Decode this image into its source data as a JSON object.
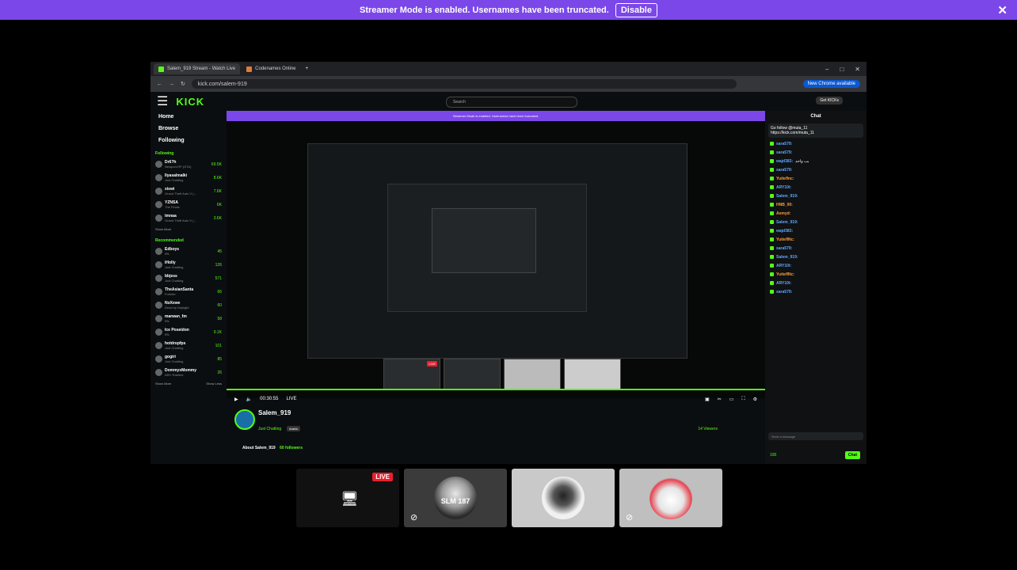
{
  "banner": {
    "message": "Streamer Mode is enabled. Usernames have been truncated.",
    "disable_label": "Disable",
    "close": "✕"
  },
  "browser": {
    "tab1": "Salem_919 Stream - Watch Live",
    "tab2": "Codenames Online",
    "new_tab": "+",
    "url": "kick.com/salem-919",
    "chrome_button": "New Chrome available",
    "controls": {
      "min": "–",
      "max": "□",
      "close": "✕"
    }
  },
  "kick": {
    "logo": "KICK",
    "search_placeholder": "Search",
    "get_kicks": "Get KICKs",
    "inner_banner": "Streamer Mode is enabled. Usernames have been truncated.",
    "nav": [
      "Home",
      "Browse",
      "Following"
    ],
    "following_title": "Following",
    "following": [
      {
        "name": "Dr6?h",
        "sub": "Newport-RP (GTA)",
        "count": "69.5K"
      },
      {
        "name": "llyasalmalki",
        "sub": "Just Chatting",
        "count": "8.6K"
      },
      {
        "name": "xiswi",
        "sub": "Grand Theft Auto V (...",
        "count": "7.6K"
      },
      {
        "name": "YZNSA",
        "sub": "The Finals",
        "count": "6K"
      },
      {
        "name": "tmnaa",
        "sub": "Grand Theft Auto V (...",
        "count": "3.6K"
      }
    ],
    "show_more": "Show More",
    "recommended_title": "Recommended",
    "recommended": [
      {
        "name": "Edboys",
        "sub": "IRL",
        "count": "45"
      },
      {
        "name": "iHolly",
        "sub": "Just Chatting",
        "count": "126"
      },
      {
        "name": "bbjess",
        "sub": "Just Chatting",
        "count": "571"
      },
      {
        "name": "TheAsianSanta",
        "sub": "Fortnite",
        "count": "66"
      },
      {
        "name": "NoXewe",
        "sub": "Dead by Daylight",
        "count": "60"
      },
      {
        "name": "marwan_fm",
        "sub": "IRL",
        "count": "58"
      },
      {
        "name": "Ice Poseidon",
        "sub": "IRL",
        "count": "9.1K"
      },
      {
        "name": "hotdropfps",
        "sub": "Just Chatting",
        "count": "101"
      },
      {
        "name": "gogiri",
        "sub": "Just Chatting",
        "count": "85"
      },
      {
        "name": "DommyxMommy",
        "sub": "ARC Raiders",
        "count": "26"
      }
    ],
    "show_less": "Show Less",
    "player": {
      "time": "00:30:55",
      "live": "LIVE"
    },
    "channel": {
      "name": "Salem_919",
      "category": "Just Chatting",
      "language": "Arabic",
      "viewers": "14 Viewers",
      "about": "About Salem_919",
      "followers": "60 followers"
    },
    "chat": {
      "title": "Chat",
      "pinned_line1": "Go follow @muta_11",
      "pinned_line2": "https://kick.com/muta_11",
      "messages": [
        {
          "user": "sara579:",
          "text": "",
          "style": "blue"
        },
        {
          "user": "sara579:",
          "text": "",
          "style": "blue"
        },
        {
          "user": "wajd383:",
          "text": "بب واحد",
          "style": "blue"
        },
        {
          "user": "sara579:",
          "text": "",
          "style": "blue"
        },
        {
          "user": "Yuiteflnc:",
          "text": "",
          "style": ""
        },
        {
          "user": "ARY10t:",
          "text": "",
          "style": "blue"
        },
        {
          "user": "Salem_919:",
          "text": "",
          "style": "blue"
        },
        {
          "user": "HNB_00:",
          "text": "",
          "style": ""
        },
        {
          "user": "Aemyd:",
          "text": "",
          "style": ""
        },
        {
          "user": "Salem_919:",
          "text": "",
          "style": "blue"
        },
        {
          "user": "wajd383:",
          "text": "",
          "style": "blue"
        },
        {
          "user": "YuiteflNc:",
          "text": "",
          "style": ""
        },
        {
          "user": "sara579:",
          "text": "",
          "style": "blue"
        },
        {
          "user": "Salem_919:",
          "text": "",
          "style": "blue"
        },
        {
          "user": "ARY10t:",
          "text": "",
          "style": "blue"
        },
        {
          "user": "YuiteflNc:",
          "text": "",
          "style": ""
        },
        {
          "user": "ARY10t:",
          "text": "",
          "style": "blue"
        },
        {
          "user": "sara579:",
          "text": "",
          "style": "blue"
        }
      ],
      "input_placeholder": "Send a message",
      "points": "100",
      "send": "Chat"
    }
  },
  "tiles": {
    "live": "LIVE",
    "tile2_label": "SLM 187",
    "screen_icon": "🖥",
    "mute_icon": "⊘"
  }
}
